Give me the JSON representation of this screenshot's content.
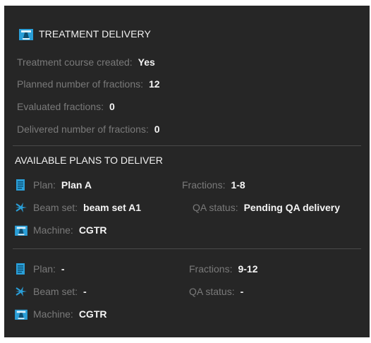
{
  "header": {
    "title": "TREATMENT DELIVERY",
    "icon": "machine-icon"
  },
  "summary": [
    {
      "label": "Treatment course created:",
      "value": "Yes"
    },
    {
      "label": "Planned number of fractions:",
      "value": "12"
    },
    {
      "label": "Evaluated fractions:",
      "value": "0"
    },
    {
      "label": "Delivered number of fractions:",
      "value": "0"
    }
  ],
  "plans_section": {
    "title": "AVAILABLE PLANS TO DELIVER"
  },
  "plans": [
    {
      "plan_label": "Plan:",
      "plan_value": "Plan A",
      "fractions_label": "Fractions:",
      "fractions_value": "1-8",
      "beamset_label": "Beam set:",
      "beamset_value": "beam set A1",
      "qa_label": "QA status:",
      "qa_value": "Pending QA delivery",
      "machine_label": "Machine:",
      "machine_value": "CGTR"
    },
    {
      "plan_label": "Plan:",
      "plan_value": "-",
      "fractions_label": "Fractions:",
      "fractions_value": "9-12",
      "beamset_label": "Beam set:",
      "beamset_value": "-",
      "qa_label": "QA status:",
      "qa_value": "-",
      "machine_label": "Machine:",
      "machine_value": "CGTR"
    }
  ],
  "colors": {
    "panel_bg": "#262626",
    "icon_blue": "#2a9fd8",
    "label": "#7a7a7a",
    "value": "#f5f5f5"
  }
}
